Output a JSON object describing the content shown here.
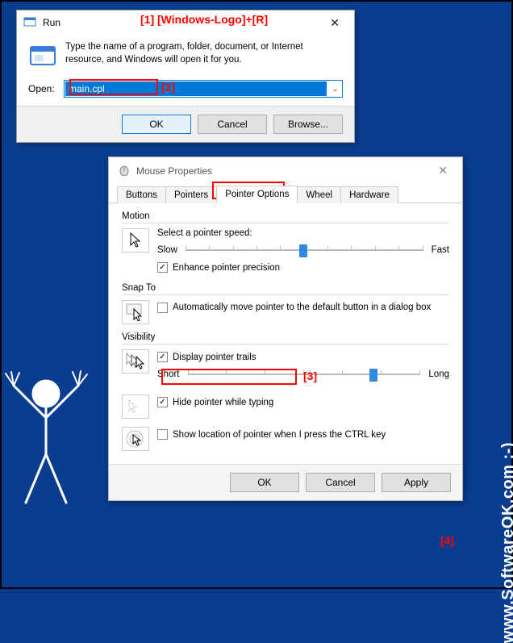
{
  "annotations": {
    "a1": "[1]  [Windows-Logo]+[R]",
    "a2": "[2]",
    "a3": "[3]",
    "a4": "[4]"
  },
  "watermark": "www.SoftwareOK.com :-)",
  "run": {
    "title": "Run",
    "description": "Type the name of a program, folder, document, or Internet resource, and Windows will open it for you.",
    "open_label": "Open:",
    "value": "main.cpl",
    "buttons": {
      "ok": "OK",
      "cancel": "Cancel",
      "browse": "Browse..."
    }
  },
  "mouse": {
    "title": "Mouse Properties",
    "tabs": [
      "Buttons",
      "Pointers",
      "Pointer Options",
      "Wheel",
      "Hardware"
    ],
    "active_tab": 2,
    "motion": {
      "title": "Motion",
      "label": "Select a pointer speed:",
      "slow": "Slow",
      "fast": "Fast",
      "enhance": "Enhance pointer precision",
      "enhance_checked": true,
      "thumb_pct": 48
    },
    "snapto": {
      "title": "Snap To",
      "label": "Automatically move pointer to the default button in a dialog box",
      "checked": false
    },
    "visibility": {
      "title": "Visibility",
      "trails_label": "Display pointer trails",
      "trails_checked": true,
      "short": "Short",
      "long": "Long",
      "trails_thumb_pct": 78,
      "hide_label": "Hide pointer while typing",
      "hide_checked": true,
      "ctrl_label": "Show location of pointer when I press the CTRL key",
      "ctrl_checked": false
    },
    "buttons": {
      "ok": "OK",
      "cancel": "Cancel",
      "apply": "Apply"
    }
  }
}
